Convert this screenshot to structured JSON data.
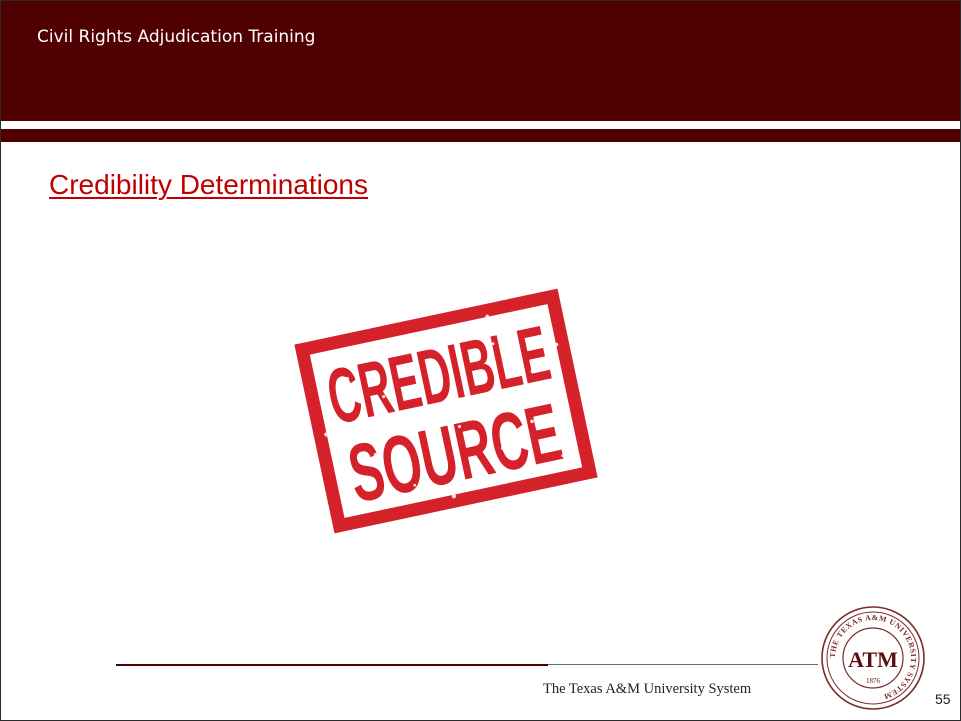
{
  "header": {
    "course_title": "Civil Rights Adjudication Training"
  },
  "slide": {
    "title": "Credibility Determinations",
    "page_number": "55"
  },
  "stamp": {
    "line1": "CREDIBLE",
    "line2": "SOURCE"
  },
  "footer": {
    "organization": "The Texas A&M University System"
  },
  "seal": {
    "ring_text": "THE TEXAS A&M UNIVERSITY SYSTEM",
    "monogram": "ATM",
    "year": "1876"
  },
  "colors": {
    "maroon": "#500000",
    "title_red": "#c00000",
    "stamp_red": "#d4212a"
  }
}
